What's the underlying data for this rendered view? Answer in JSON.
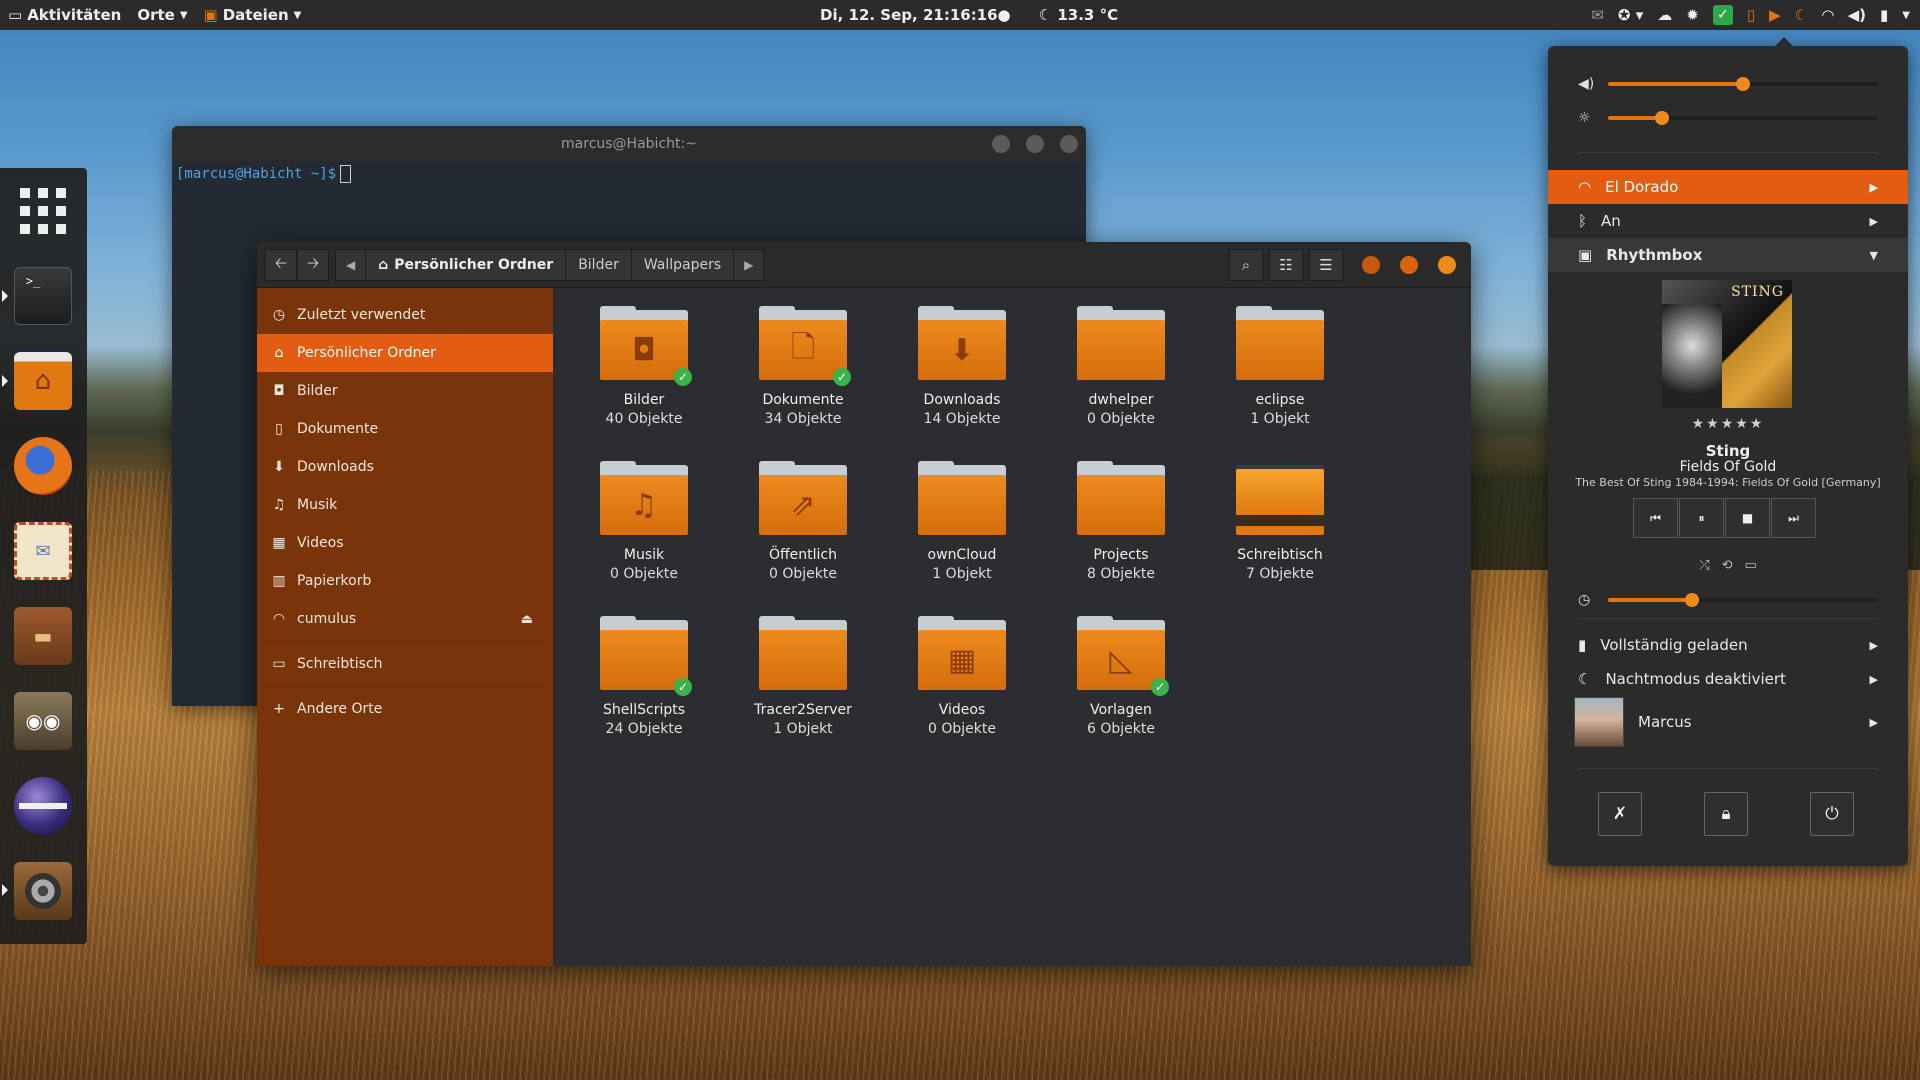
{
  "top_panel": {
    "activities": "Aktivitäten",
    "places": "Orte",
    "files_app": "Dateien",
    "clock": "Di, 12. Sep, 21:16:16●",
    "weather": "13.3 °C",
    "tray_icons": [
      "mail-icon",
      "accessibility-icon",
      "chevron-down-icon",
      "weather-cloud-icon",
      "settings-gear-icon",
      "checkbox-icon",
      "clipboard-icon",
      "play-icon",
      "night-icon",
      "wifi-icon",
      "volume-icon",
      "battery-icon",
      "chevron-down-icon"
    ]
  },
  "dock": {
    "items": [
      "app-grid",
      "terminal",
      "files",
      "firefox",
      "mail",
      "wallet",
      "gimp",
      "eclipse",
      "rhythmbox"
    ]
  },
  "terminal": {
    "title": "marcus@Habicht:~",
    "prompt": "[marcus@Habicht ~]$"
  },
  "files": {
    "breadcrumbs": [
      "Persönlicher Ordner",
      "Bilder",
      "Wallpapers"
    ],
    "sidebar": [
      {
        "label": "Zuletzt verwendet",
        "icon": "clock-icon"
      },
      {
        "label": "Persönlicher Ordner",
        "icon": "home-icon",
        "selected": true
      },
      {
        "label": "Bilder",
        "icon": "pictures-icon"
      },
      {
        "label": "Dokumente",
        "icon": "document-icon"
      },
      {
        "label": "Downloads",
        "icon": "download-icon"
      },
      {
        "label": "Musik",
        "icon": "music-icon"
      },
      {
        "label": "Videos",
        "icon": "video-icon"
      },
      {
        "label": "Papierkorb",
        "icon": "trash-icon"
      },
      {
        "label": "cumulus",
        "icon": "wifi-icon"
      },
      {
        "label": "Schreibtisch",
        "icon": "desktop-icon"
      },
      {
        "label": "Andere Orte",
        "icon": "plus-icon"
      }
    ],
    "folders": [
      {
        "name": "Bilder",
        "count": "40 Objekte",
        "emblem": "◘",
        "synced": true
      },
      {
        "name": "Dokumente",
        "count": "34 Objekte",
        "emblem": "🗋",
        "synced": true
      },
      {
        "name": "Downloads",
        "count": "14 Objekte",
        "emblem": "⬇",
        "synced": false
      },
      {
        "name": "dwhelper",
        "count": "0 Objekte",
        "emblem": "",
        "synced": false
      },
      {
        "name": "eclipse",
        "count": "1 Objekt",
        "emblem": "",
        "synced": false
      },
      {
        "name": "Musik",
        "count": "0 Objekte",
        "emblem": "♫",
        "synced": false
      },
      {
        "name": "Öffentlich",
        "count": "0 Objekte",
        "emblem": "⇗",
        "synced": false
      },
      {
        "name": "ownCloud",
        "count": "1 Objekt",
        "emblem": "",
        "synced": false
      },
      {
        "name": "Projects",
        "count": "8 Objekte",
        "emblem": "",
        "synced": false
      },
      {
        "name": "Schreibtisch",
        "count": "7 Objekte",
        "emblem": "",
        "synced": false,
        "desktop": true
      },
      {
        "name": "ShellScripts",
        "count": "24 Objekte",
        "emblem": "",
        "synced": true
      },
      {
        "name": "Tracer2Server",
        "count": "1 Objekt",
        "emblem": "",
        "synced": false
      },
      {
        "name": "Videos",
        "count": "0 Objekte",
        "emblem": "▦",
        "synced": false
      },
      {
        "name": "Vorlagen",
        "count": "6 Objekte",
        "emblem": "◺",
        "synced": true
      }
    ]
  },
  "system_menu": {
    "volume_level": 0.5,
    "brightness_level": 0.2,
    "wifi": "El Dorado",
    "bluetooth": "An",
    "player_name": "Rhythmbox",
    "album_label": "STING",
    "stars": "★★★★★",
    "artist": "Sting",
    "song": "Fields Of Gold",
    "album": "The Best Of Sting 1984-1994: Fields Of Gold [Germany]",
    "position_level": 0.31,
    "battery": "Vollständig geladen",
    "night_mode": "Nachtmodus deaktiviert",
    "user": "Marcus"
  },
  "colors": {
    "accent": "#e25c12",
    "sidebar": "#7a340a",
    "folder": "#e07812",
    "panel": "#2b2b2b"
  }
}
